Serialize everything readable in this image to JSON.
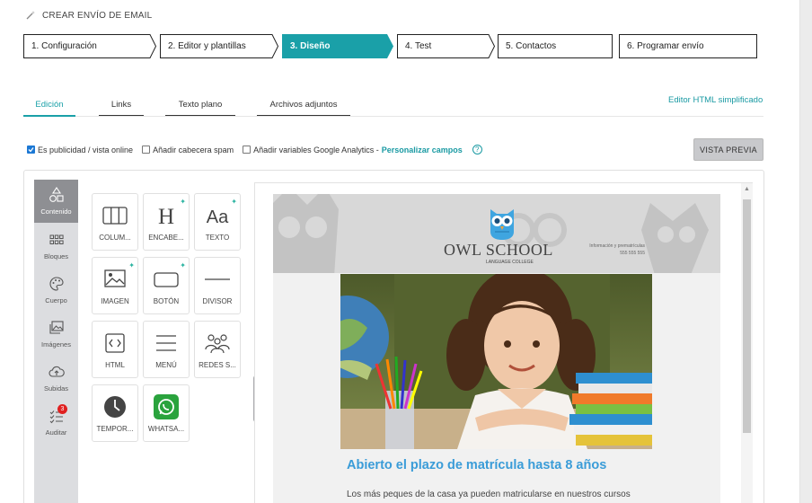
{
  "title": "CREAR ENVÍO DE EMAIL",
  "steps": [
    "1. Configuración",
    "2. Editor y plantillas",
    "3. Diseño",
    "4. Test",
    "5. Contactos",
    "6. Programar envío"
  ],
  "active_step": 2,
  "tabs": [
    "Edición",
    "Links",
    "Texto plano",
    "Archivos adjuntos"
  ],
  "active_tab": 0,
  "html_link": "Editor HTML simplificado",
  "options": {
    "publicidad": "Es publicidad / vista online",
    "cabecera": "Añadir cabecera spam",
    "analytics": "Añadir variables Google Analytics -",
    "personalizar": "Personalizar campos",
    "help": "?"
  },
  "preview_button": "VISTA PREVIA",
  "sidebar": [
    {
      "label": "Contenido",
      "icon": "shapes-icon"
    },
    {
      "label": "Bloques",
      "icon": "grid-icon"
    },
    {
      "label": "Cuerpo",
      "icon": "palette-icon"
    },
    {
      "label": "Imágenes",
      "icon": "images-icon"
    },
    {
      "label": "Subidas",
      "icon": "cloud-upload-icon"
    },
    {
      "label": "Auditar",
      "icon": "checklist-icon",
      "badge": "3"
    }
  ],
  "blocks": [
    {
      "label": "COLUM...",
      "icon": "columns-icon"
    },
    {
      "label": "ENCABE...",
      "icon": "heading-icon",
      "new": true
    },
    {
      "label": "TEXTO",
      "icon": "text-icon",
      "new": true
    },
    {
      "label": "IMAGEN",
      "icon": "image-icon",
      "new": true
    },
    {
      "label": "BOTÓN",
      "icon": "button-icon",
      "new": true
    },
    {
      "label": "DIVISOR",
      "icon": "divider-icon"
    },
    {
      "label": "HTML",
      "icon": "html-icon"
    },
    {
      "label": "MENÚ",
      "icon": "menu-icon"
    },
    {
      "label": "REDES S...",
      "icon": "social-icon"
    },
    {
      "label": "TEMPOR...",
      "icon": "clock-icon"
    },
    {
      "label": "WHATSA...",
      "icon": "whatsapp-icon"
    }
  ],
  "email": {
    "brand": "OWL SCHOOL",
    "tagline": "LANGUAGE COLLEGE",
    "info_line1": "Información y prematrículas",
    "info_line2": "555 555 555",
    "headline": "Abierto el plazo de matrícula hasta 8 años",
    "body": "Los más peques de la casa ya pueden matricularse en nuestros cursos"
  },
  "colors": {
    "accent": "#1aa0a8",
    "headline": "#3a9cd8",
    "active_step": "#1aa0a8"
  }
}
